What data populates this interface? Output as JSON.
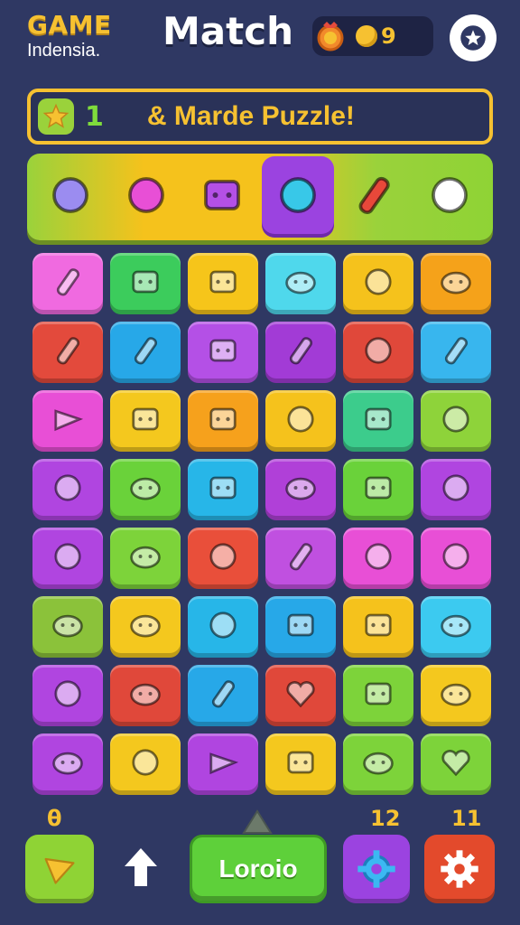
{
  "header": {
    "brand_line1": "GAME",
    "brand_line2": "Indensia.",
    "title": "Match",
    "coins": "9"
  },
  "banner": {
    "level": "1",
    "message": "& Marde Puzzle!"
  },
  "powerups": [
    {
      "icon": "target-icon"
    },
    {
      "icon": "donut-icon"
    },
    {
      "icon": "gamepad-icon"
    },
    {
      "icon": "wrench-icon",
      "selected": true
    },
    {
      "icon": "racket-icon"
    },
    {
      "icon": "gear-ball-icon"
    }
  ],
  "grid": {
    "columns": 6,
    "rows": [
      [
        "#f06ae0",
        "#3ccc5c",
        "#f6c51a",
        "#4fd8ec",
        "#f5c21c",
        "#f5a21a"
      ],
      [
        "#e34a3c",
        "#27a8e8",
        "#b450e6",
        "#a23bd6",
        "#e0483a",
        "#38b6ee"
      ],
      [
        "#e84fd6",
        "#f4c81e",
        "#f6a11c",
        "#f5c21c",
        "#3ccc8c",
        "#8ed33a"
      ],
      [
        "#b045e0",
        "#6ad23a",
        "#27b6e8",
        "#b040d8",
        "#6ad23a",
        "#b045e0"
      ],
      [
        "#b045e0",
        "#7dd33a",
        "#e94f3a",
        "#c050e0",
        "#e84fd6",
        "#e84fd6"
      ],
      [
        "#8bc23a",
        "#f4c81e",
        "#27b6e8",
        "#27a8e8",
        "#f5c21c",
        "#3ccaf0"
      ],
      [
        "#b045e0",
        "#e0483a",
        "#27a8e8",
        "#e0483a",
        "#7dd33a",
        "#f4c81e"
      ],
      [
        "#b045e0",
        "#f4c81e",
        "#b045e0",
        "#f4c81e",
        "#7dd33a",
        "#7dd33a"
      ]
    ],
    "icons": [
      [
        "racket-icon",
        "robot-icon",
        "bag-icon",
        "frog-icon",
        "apple-icon",
        "monster-icon"
      ],
      [
        "bottle-icon",
        "rocket-icon",
        "robot-icon",
        "rocket-icon",
        "bulb-icon",
        "wand-icon"
      ],
      [
        "flag-icon",
        "gamepad-icon",
        "face-icon",
        "apple-icon",
        "tv-icon",
        "sun-icon"
      ],
      [
        "ring-icon",
        "blob-icon",
        "gamepad-icon",
        "plus-icon",
        "gamepad-icon",
        "yarn-icon"
      ],
      [
        "balloon-icon",
        "plate-icon",
        "magnifier-icon",
        "pencil-icon",
        "bell-icon",
        "apple-icon"
      ],
      [
        "turtle-icon",
        "star-monster-icon",
        "balloon-icon",
        "dice-icon",
        "box-icon",
        "fish-icon"
      ],
      [
        "pineapple-icon",
        "fish-icon",
        "pencil-icon",
        "heart-icon",
        "gamepad-icon",
        "blob-icon"
      ],
      [
        "boot-icon",
        "tree-icon",
        "cone-icon",
        "face-icon",
        "monster-icon",
        "heart-brush-icon"
      ]
    ]
  },
  "bottom": {
    "count_left": "θ",
    "count_middle": "12",
    "count_right": "11",
    "play_label": "Loroio"
  },
  "colors": {
    "background": "#2f3863",
    "accent": "#f6c131",
    "green": "#5ed03a"
  }
}
